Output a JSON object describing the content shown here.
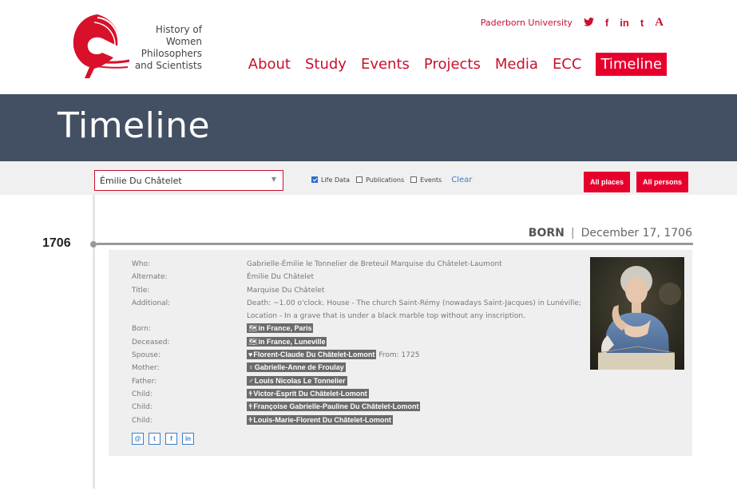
{
  "header": {
    "logo_lines": [
      "History of",
      "Women",
      "Philosophers",
      "and Scientists"
    ],
    "university_link": "Paderborn University",
    "social": [
      {
        "name": "twitter-icon",
        "glyph": "🐦"
      },
      {
        "name": "facebook-icon",
        "glyph": "f"
      },
      {
        "name": "linkedin-icon",
        "glyph": "in"
      },
      {
        "name": "tumblr-icon",
        "glyph": "t"
      },
      {
        "name": "academia-icon",
        "glyph": "A"
      }
    ],
    "nav": [
      "About",
      "Study",
      "Events",
      "Projects",
      "Media",
      "ECC",
      "Timeline"
    ],
    "active_nav": "Timeline",
    "accent_color": "#e8002d"
  },
  "banner": {
    "title": "Timeline",
    "bg_color": "#435063"
  },
  "filters": {
    "person_select": "Émilie Du Châtelet",
    "checkboxes": [
      {
        "label": "Life Data",
        "checked": true
      },
      {
        "label": "Publications",
        "checked": false
      },
      {
        "label": "Events",
        "checked": false
      }
    ],
    "clear_label": "Clear",
    "all_places_label": "All places",
    "all_persons_label": "All persons"
  },
  "timeline": {
    "year": "1706",
    "event_type": "BORN",
    "separator": "|",
    "event_date": "December 17, 1706"
  },
  "details": {
    "who_label": "Who:",
    "who": "Gabrielle-Émilie le Tonnelier de Breteuil Marquise du Châtelet-Laumont",
    "alternate_label": "Alternate:",
    "alternate": "Émilie Du Châtelet",
    "title_label": "Title:",
    "title": "Marquise Du Châtelet",
    "additional_label": "Additional:",
    "additional": "Death: ~1.00 o'clock. House - The church Saint-Rémy (nowadays Saint-Jacques) in Lunéville; Location - In a grave that is under a black marble top without any inscription.",
    "born_label": "Born:",
    "born_place": "in France, Paris",
    "deceased_label": "Deceased:",
    "deceased_place": "in France, Luneville",
    "spouse_label": "Spouse:",
    "spouse": "Florent-Claude Du Châtelet-Lomont",
    "spouse_from": "From: 1725",
    "mother_label": "Mother:",
    "mother": "Gabrielle-Anne de Froulay",
    "father_label": "Father:",
    "father": "Louis Nicolas Le Tonnelier",
    "child_label": "Child:",
    "children": [
      "Victor-Esprit Du Châtelet-Lomont",
      "Françoise Gabrielle-Pauline Du Châtelet-Lomont",
      "Louis-Marie-Florent Du Châtelet-Lomont"
    ],
    "share_icons": [
      "email-icon",
      "twitter-icon",
      "facebook-icon",
      "linkedin-icon"
    ]
  }
}
